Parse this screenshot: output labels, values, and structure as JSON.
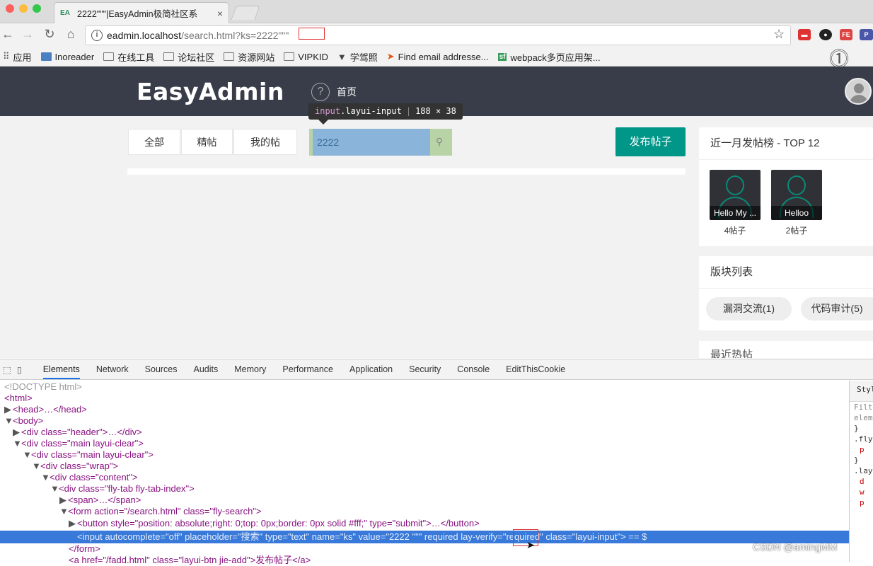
{
  "browser": {
    "tab_title": "2222\"\"\"|EasyAdmin极简社区系",
    "tab_favicon": "EA",
    "url_host": "eadmin.localhost",
    "url_rest": "/search.html?ks=2222\"\"\"",
    "bookmarks": [
      "应用",
      "Inoreader",
      "在线工具",
      "论坛社区",
      "资源网站",
      "VIPKID",
      "学驾照",
      "Find email addresse...",
      "webpack多页应用架..."
    ]
  },
  "site": {
    "logo": "EasyAdmin",
    "nav_home": "首页",
    "tabs": [
      "全部",
      "精帖",
      "我的帖"
    ],
    "search_value": "2222",
    "publish_button": "发布帖子",
    "tooltip": {
      "selector": "input",
      "class": ".layui-input",
      "size": "188 × 38"
    },
    "top_panel_title": "近一月发帖榜 - TOP 12",
    "top_users": [
      {
        "name": "Hello My ...",
        "posts": "4帖子"
      },
      {
        "name": "Helloo",
        "posts": "2帖子"
      }
    ],
    "board_panel_title": "版块列表",
    "boards": [
      "漏洞交流(1)",
      "代码审计(5)"
    ],
    "hot_panel_title": "最近热帖"
  },
  "devtools": {
    "tabs": [
      "Elements",
      "Network",
      "Sources",
      "Audits",
      "Memory",
      "Performance",
      "Application",
      "Security",
      "Console",
      "EditThisCookie"
    ],
    "active_tab": "Elements",
    "styles_tab": "Styl",
    "styles_lines": [
      "Filte",
      "elem",
      "}",
      ".fly",
      "p",
      "}",
      ".lay",
      "d",
      "w",
      "p"
    ],
    "dom_lines": [
      "<!DOCTYPE html>",
      "<html>",
      "<head>…</head>",
      "<body>",
      "<div class=\"header\">…</div>",
      "<div class=\"main layui-clear\">",
      "<div class=\"main layui-clear\">",
      "<div class=\"wrap\">",
      "<div class=\"content\">",
      "<div class=\"fly-tab fly-tab-index\">",
      "<span>…</span>",
      "<form action=\"/search.html\" class=\"fly-search\">",
      "<button style=\"position: absolute;right: 0;top: 0px;border: 0px solid #fff;\" type=\"submit\">…</button>",
      "<input autocomplete=\"off\" placeholder=\"搜索\" type=\"text\" name=\"ks\" value=\"2222 \"\"\" required lay-verify=\"required\" class=\"layui-input\"> == $",
      "</form>",
      "<a href=\"/fadd.html\" class=\"layui-btn jie-add\">发布帖子</a>"
    ]
  },
  "watermark": "CSDN @amingMM"
}
